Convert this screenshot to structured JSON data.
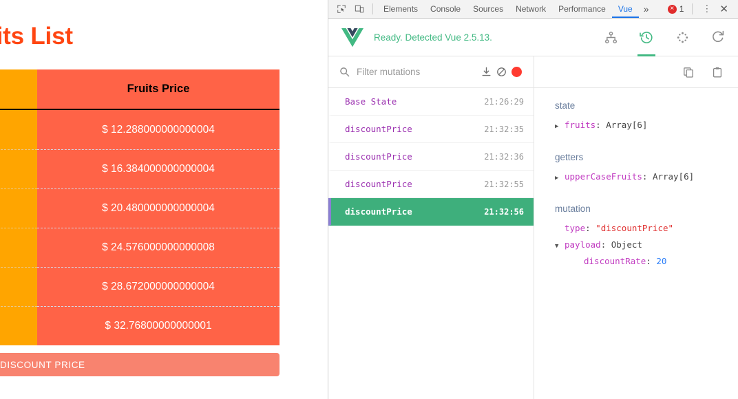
{
  "page": {
    "title": "ruits List",
    "table": {
      "header_price": "Fruits Price",
      "rows": [
        {
          "price": "$ 12.288000000000004"
        },
        {
          "price": "$ 16.384000000000004"
        },
        {
          "price": "$ 20.480000000000004"
        },
        {
          "price": "$ 24.576000000000008"
        },
        {
          "price": "$ 28.672000000000004"
        },
        {
          "price": "$ 32.76800000000001"
        }
      ]
    },
    "discount_button": "DISCOUNT PRICE",
    "colors": {
      "title": "#ff4612",
      "name_column": "#ffa500",
      "price_column": "#ff6347",
      "button": "#f8836f"
    }
  },
  "devtools": {
    "tabbar": {
      "inspect_icon": "inspect-element-icon",
      "device_icon": "device-toolbar-icon",
      "tabs": [
        {
          "label": "Elements",
          "active": false
        },
        {
          "label": "Console",
          "active": false
        },
        {
          "label": "Sources",
          "active": false
        },
        {
          "label": "Network",
          "active": false
        },
        {
          "label": "Performance",
          "active": false
        },
        {
          "label": "Vue",
          "active": true
        }
      ],
      "more_label": "»",
      "error_count": "1",
      "error_glyph": "×",
      "menu_label": "⋮",
      "close_label": "✕"
    },
    "vue_header": {
      "logo": "vue-logo-icon",
      "status": "Ready. Detected Vue 2.5.13.",
      "tools": [
        {
          "name": "components-tree-icon",
          "active": false
        },
        {
          "name": "vuex-history-icon",
          "active": true
        },
        {
          "name": "events-icon",
          "active": false
        },
        {
          "name": "refresh-icon",
          "active": false
        }
      ],
      "accent": "#42b983"
    },
    "mutations": {
      "filter_placeholder": "Filter mutations",
      "filter_value": "",
      "toolbar_icons": [
        "export-icon",
        "clear-icon",
        "record-icon"
      ],
      "items": [
        {
          "name": "Base State",
          "time": "21:26:29",
          "selected": false
        },
        {
          "name": "discountPrice",
          "time": "21:32:35",
          "selected": false
        },
        {
          "name": "discountPrice",
          "time": "21:32:36",
          "selected": false
        },
        {
          "name": "discountPrice",
          "time": "21:32:55",
          "selected": false
        },
        {
          "name": "discountPrice",
          "time": "21:32:56",
          "selected": true
        }
      ],
      "selected_bg": "#3eaf7c",
      "selected_border": "#8b7fd4"
    },
    "inspector": {
      "copy_icon": "copy-icon",
      "paste_icon": "paste-icon",
      "state": {
        "title": "state",
        "key": "fruits",
        "value": "Array[6]",
        "arrow": "▶"
      },
      "getters": {
        "title": "getters",
        "key": "upperCaseFruits",
        "value": "Array[6]",
        "arrow": "▶"
      },
      "mutation": {
        "title": "mutation",
        "type_key": "type",
        "type_value": "\"discountPrice\"",
        "payload_key": "payload",
        "payload_value": "Object",
        "payload_arrow": "▼",
        "discount_key": "discountRate",
        "discount_value": "20"
      }
    }
  }
}
